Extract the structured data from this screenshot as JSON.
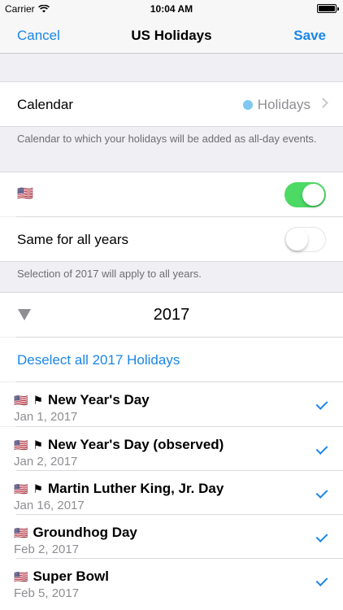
{
  "status": {
    "carrier": "Carrier",
    "time": "10:04 AM"
  },
  "nav": {
    "cancel": "Cancel",
    "title": "US Holidays",
    "save": "Save"
  },
  "calendar": {
    "label": "Calendar",
    "value": "Holidays",
    "dot_color": "#7ec8f2"
  },
  "calendar_note": "Calendar to which your holidays will be added as all-day events.",
  "country": {
    "flag": "🇺🇸",
    "enabled": true
  },
  "same_years": {
    "label": "Same for all years",
    "enabled": false
  },
  "same_note": "Selection of 2017 will apply to all years.",
  "year": "2017",
  "deselect": "Deselect all 2017 Holidays",
  "holidays": [
    {
      "flag": "🇺🇸",
      "marker": "⚑",
      "name": "New Year's Day",
      "date": "Jan 1, 2017",
      "checked": true
    },
    {
      "flag": "🇺🇸",
      "marker": "⚑",
      "name": "New Year's Day (observed)",
      "date": "Jan 2, 2017",
      "checked": true
    },
    {
      "flag": "🇺🇸",
      "marker": "⚑",
      "name": "Martin Luther King, Jr. Day",
      "date": "Jan 16, 2017",
      "checked": true
    },
    {
      "flag": "🇺🇸",
      "marker": "",
      "name": "Groundhog Day",
      "date": "Feb 2, 2017",
      "checked": true
    },
    {
      "flag": "🇺🇸",
      "marker": "",
      "name": "Super Bowl",
      "date": "Feb 5, 2017",
      "checked": true
    }
  ],
  "colors": {
    "tint": "#1a86e8",
    "switch_on": "#4cd964",
    "secondary": "#8e8e93"
  }
}
